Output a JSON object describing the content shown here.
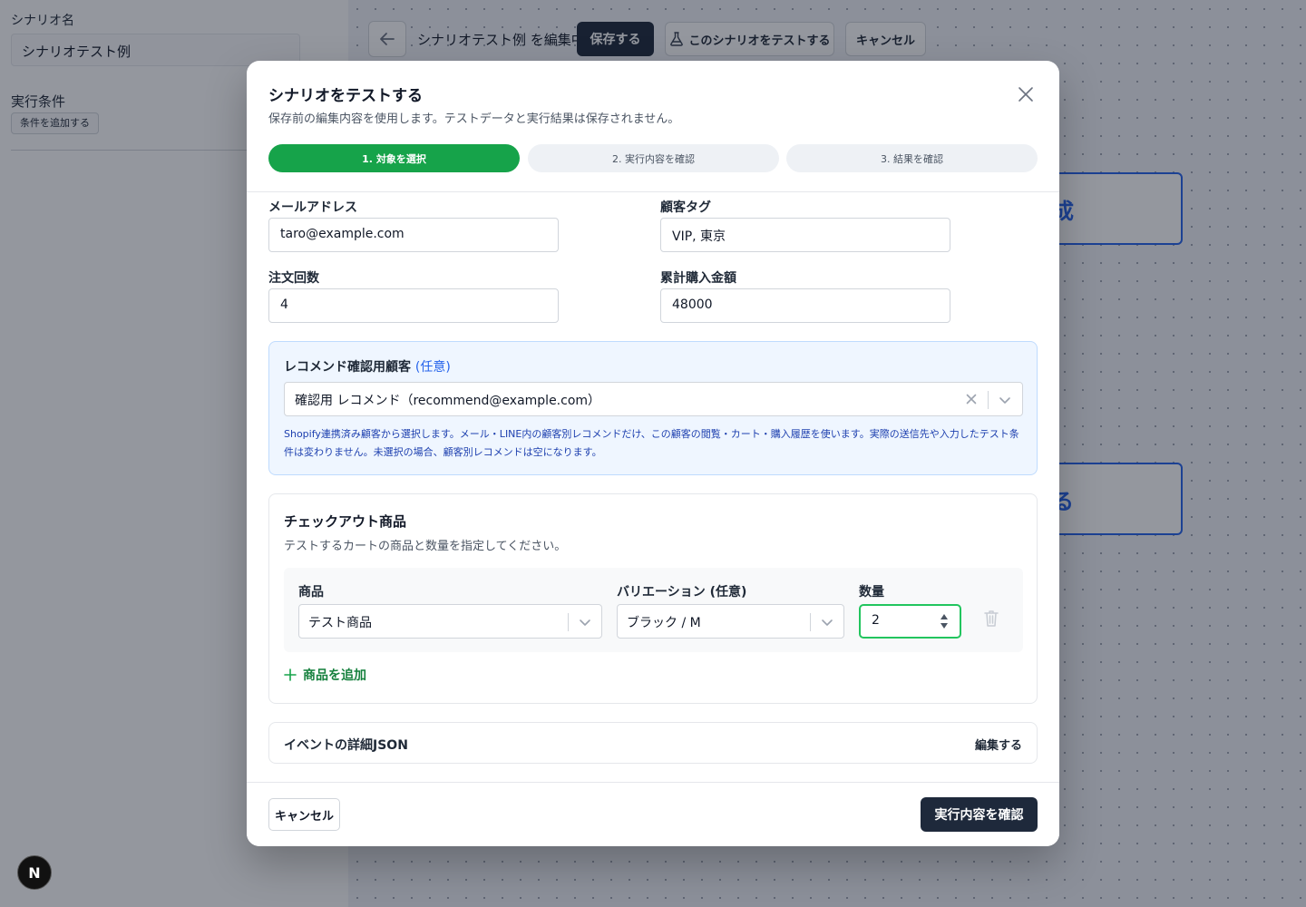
{
  "sidebar": {
    "scenario_name_label": "シナリオ名",
    "scenario_name_value": "シナリオテスト例",
    "conditions_label": "実行条件",
    "add_condition_button": "条件を追加する"
  },
  "topbar": {
    "editing_title": "シナリオテスト例 を編集中",
    "save_button": "保存する",
    "test_button": "このシナリオをテストする",
    "cancel_button": "キャンセル"
  },
  "canvas": {
    "node_1_text": "成",
    "node_2_text": "る"
  },
  "modal": {
    "title": "シナリオをテストする",
    "description": "保存前の編集内容を使用します。テストデータと実行結果は保存されません。",
    "steps": [
      {
        "label": "1. 対象を選択",
        "active": true
      },
      {
        "label": "2. 実行内容を確認",
        "active": false
      },
      {
        "label": "3. 結果を確認",
        "active": false
      }
    ],
    "fields": {
      "email_label": "メールアドレス",
      "email_value": "taro@example.com",
      "customer_tag_label": "顧客タグ",
      "customer_tag_value": "VIP, 東京",
      "order_count_label": "注文回数",
      "order_count_value": "4",
      "total_purchase_label": "累計購入金額",
      "total_purchase_value": "48000"
    },
    "recommend": {
      "title": "レコメンド確認用顧客",
      "optional": "(任意)",
      "selected": "確認用 レコメンド（recommend@example.com）",
      "help": "Shopify連携済み顧客から選択します。メール・LINE内の顧客別レコメンドだけ、この顧客の閲覧・カート・購入履歴を使います。実際の送信先や入力したテスト条件は変わりません。未選択の場合、顧客別レコメンドは空になります。"
    },
    "checkout": {
      "title": "チェックアウト商品",
      "description": "テストするカートの商品と数量を指定してください。",
      "product_label": "商品",
      "product_value": "テスト商品",
      "variation_label": "バリエーション (任意)",
      "variation_value": "ブラック / M",
      "quantity_label": "数量",
      "quantity_value": "2",
      "add_product": "商品を追加"
    },
    "json": {
      "title": "イベントの詳細JSON",
      "edit": "編集する"
    },
    "footer": {
      "cancel": "キャンセル",
      "confirm": "実行内容を確認"
    }
  },
  "badge": "N",
  "colors": {
    "primary_dark": "#1e293b",
    "step_active": "#16a34a",
    "info_bg": "#eff6ff",
    "info_text": "#1e40af",
    "accent_blue": "#2563eb",
    "focus_green": "#22c55e"
  }
}
